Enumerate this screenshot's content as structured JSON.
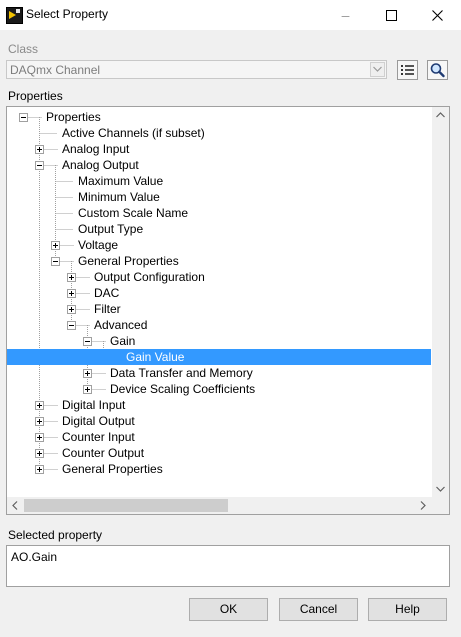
{
  "window": {
    "title": "Select Property",
    "minimize_glyph": "–",
    "icon": "labview-app-icon"
  },
  "class_section": {
    "label": "Class",
    "value": "DAQmx Channel"
  },
  "properties_section": {
    "label": "Properties",
    "tree": [
      {
        "label": "Properties",
        "depth": 0,
        "expander": "minus"
      },
      {
        "label": "Active Channels (if subset)",
        "depth": 1,
        "expander": "none"
      },
      {
        "label": "Analog Input",
        "depth": 1,
        "expander": "plus"
      },
      {
        "label": "Analog Output",
        "depth": 1,
        "expander": "minus"
      },
      {
        "label": "Maximum Value",
        "depth": 2,
        "expander": "none"
      },
      {
        "label": "Minimum Value",
        "depth": 2,
        "expander": "none"
      },
      {
        "label": "Custom Scale Name",
        "depth": 2,
        "expander": "none"
      },
      {
        "label": "Output Type",
        "depth": 2,
        "expander": "none"
      },
      {
        "label": "Voltage",
        "depth": 2,
        "expander": "plus"
      },
      {
        "label": "General Properties",
        "depth": 2,
        "expander": "minus"
      },
      {
        "label": "Output Configuration",
        "depth": 3,
        "expander": "plus"
      },
      {
        "label": "DAC",
        "depth": 3,
        "expander": "plus"
      },
      {
        "label": "Filter",
        "depth": 3,
        "expander": "plus"
      },
      {
        "label": "Advanced",
        "depth": 3,
        "expander": "minus"
      },
      {
        "label": "Gain",
        "depth": 4,
        "expander": "minus"
      },
      {
        "label": "Gain Value",
        "depth": 5,
        "expander": "none",
        "selected": true
      },
      {
        "label": "Data Transfer and Memory",
        "depth": 4,
        "expander": "plus"
      },
      {
        "label": "Device Scaling Coefficients",
        "depth": 4,
        "expander": "plus"
      },
      {
        "label": "Digital Input",
        "depth": 1,
        "expander": "plus"
      },
      {
        "label": "Digital Output",
        "depth": 1,
        "expander": "plus"
      },
      {
        "label": "Counter Input",
        "depth": 1,
        "expander": "plus"
      },
      {
        "label": "Counter Output",
        "depth": 1,
        "expander": "plus"
      },
      {
        "label": "General Properties",
        "depth": 1,
        "expander": "plus"
      }
    ]
  },
  "selected_section": {
    "label": "Selected property",
    "value": "AO.Gain"
  },
  "buttons": {
    "ok": "OK",
    "cancel": "Cancel",
    "help": "Help"
  },
  "colors": {
    "selection": "#3399ff",
    "window_bg": "#f0f0f0"
  }
}
